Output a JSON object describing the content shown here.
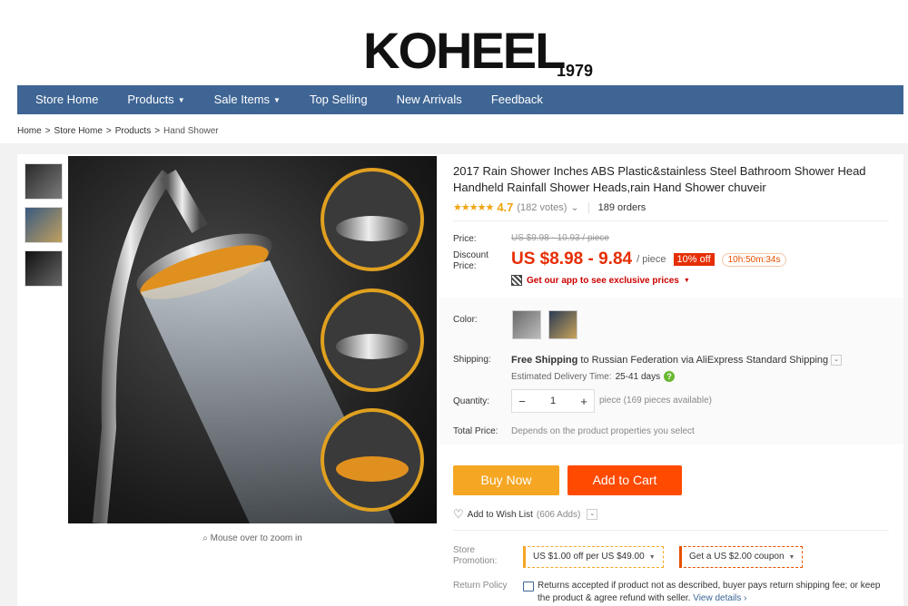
{
  "store": {
    "logo_text": "KOHEEL",
    "logo_year": "1979"
  },
  "nav": {
    "items": [
      {
        "label": "Store Home",
        "has_caret": false
      },
      {
        "label": "Products",
        "has_caret": true
      },
      {
        "label": "Sale Items",
        "has_caret": true
      },
      {
        "label": "Top Selling",
        "has_caret": false
      },
      {
        "label": "New Arrivals",
        "has_caret": false
      },
      {
        "label": "Feedback",
        "has_caret": false
      }
    ]
  },
  "breadcrumb": [
    "Home",
    "Store Home",
    "Products",
    "Hand Shower"
  ],
  "gallery": {
    "zoom_hint": "Mouse over to zoom in"
  },
  "product": {
    "title": "2017 Rain Shower Inches ABS Plastic&stainless Steel Bathroom Shower Head Handheld Rainfall Shower Heads,rain Hand Shower chuveir",
    "rating": {
      "stars": "★★★★★",
      "value": "4.7",
      "votes": "(182 votes)",
      "orders": "189 orders"
    },
    "price": {
      "label": "Price:",
      "original": "US $9.98 - 10.93 / piece",
      "discount_label": "Discount Price:",
      "discount": "US $8.98 - 9.84",
      "unit": "/ piece",
      "off_badge": "10% off",
      "timer": "10h:50m:34s"
    },
    "app_promo": "Get our app to see exclusive prices",
    "color_label": "Color:",
    "shipping": {
      "label": "Shipping:",
      "free": "Free Shipping",
      "text": "to Russian Federation via AliExpress Standard Shipping",
      "est_label": "Estimated Delivery Time:",
      "est_value": "25-41 days"
    },
    "quantity": {
      "label": "Quantity:",
      "value": "1",
      "minus": "−",
      "plus": "+",
      "note": "piece (169 pieces available)"
    },
    "total": {
      "label": "Total Price:",
      "note": "Depends on the product properties you select"
    },
    "buttons": {
      "buy_now": "Buy Now",
      "add_to_cart": "Add to Cart"
    },
    "wishlist": {
      "label": "Add to Wish List",
      "count": "(606 Adds)"
    },
    "store_promotion": {
      "label": "Store Promotion:",
      "coupon1": "US $1.00 off per US $49.00",
      "coupon2": "Get a US $2.00 coupon"
    },
    "return_policy": {
      "label": "Return Policy",
      "text": "Returns accepted if product not as described, buyer pays return shipping fee; or keep the product & agree refund with seller.",
      "link": "View details"
    }
  },
  "icons": {
    "caret": "caret-down-icon",
    "heart": "heart-icon",
    "help": "help-icon",
    "qr": "qr-code-icon",
    "zoom": "magnifier-icon"
  },
  "colors": {
    "nav_bg": "#3e6594",
    "price_red": "#e62e04",
    "buy_now": "#f5a623",
    "add_to_cart": "#ff4a00",
    "star": "#f0a30a"
  }
}
